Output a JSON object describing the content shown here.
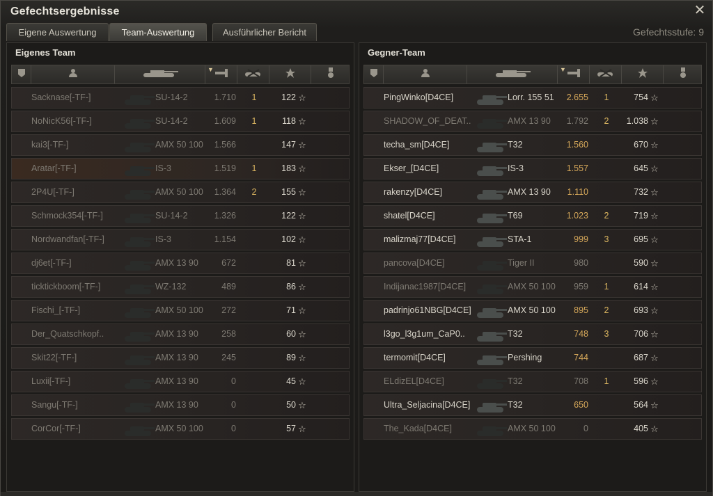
{
  "window": {
    "title": "Gefechtsergebnisse"
  },
  "tabs": [
    {
      "label": "Eigene Auswertung",
      "active": false
    },
    {
      "label": "Team-Auswertung",
      "active": true
    },
    {
      "label": "Ausführlicher Bericht",
      "active": false
    }
  ],
  "battle_tier": "Gefechtsstufe: 9",
  "colors": {
    "accent": "#d9b460",
    "enemy_damage": "#d6a85a",
    "highlight_row": "#3a2a20"
  },
  "header_icons": [
    "badge-icon",
    "player-icon",
    "tank-icon",
    "damage-icon",
    "kills-icon",
    "star-icon",
    "medal-icon"
  ],
  "own_team": {
    "title": "Eigenes Team",
    "players": [
      {
        "name": "Sacknase[-TF-]",
        "vehicle": "SU-14-2",
        "damage": "1.710",
        "kills": "1",
        "xp": "122",
        "dead": true
      },
      {
        "name": "NoNicK56[-TF-]",
        "vehicle": "SU-14-2",
        "damage": "1.609",
        "kills": "1",
        "xp": "118",
        "dead": true
      },
      {
        "name": "kai3[-TF-]",
        "vehicle": "AMX 50 100",
        "damage": "1.566",
        "kills": "",
        "xp": "147",
        "dead": true
      },
      {
        "name": "Aratar[-TF-]",
        "vehicle": "IS-3",
        "damage": "1.519",
        "kills": "1",
        "xp": "183",
        "dead": true,
        "highlight": true
      },
      {
        "name": "2P4U[-TF-]",
        "vehicle": "AMX 50 100",
        "damage": "1.364",
        "kills": "2",
        "xp": "155",
        "dead": true
      },
      {
        "name": "Schmock354[-TF-]",
        "vehicle": "SU-14-2",
        "damage": "1.326",
        "kills": "",
        "xp": "122",
        "dead": true
      },
      {
        "name": "Nordwandfan[-TF-]",
        "vehicle": "IS-3",
        "damage": "1.154",
        "kills": "",
        "xp": "102",
        "dead": true
      },
      {
        "name": "dj6et[-TF-]",
        "vehicle": "AMX 13 90",
        "damage": "672",
        "kills": "",
        "xp": "81",
        "dead": true
      },
      {
        "name": "ticktickboom[-TF-]",
        "vehicle": "WZ-132",
        "damage": "489",
        "kills": "",
        "xp": "86",
        "dead": true
      },
      {
        "name": "Fischi_[-TF-]",
        "vehicle": "AMX 50 100",
        "damage": "272",
        "kills": "",
        "xp": "71",
        "dead": true
      },
      {
        "name": "Der_Quatschkopf..",
        "vehicle": "AMX 13 90",
        "damage": "258",
        "kills": "",
        "xp": "60",
        "dead": true
      },
      {
        "name": "Skit22[-TF-]",
        "vehicle": "AMX 13 90",
        "damage": "245",
        "kills": "",
        "xp": "89",
        "dead": true
      },
      {
        "name": "Luxii[-TF-]",
        "vehicle": "AMX 13 90",
        "damage": "0",
        "kills": "",
        "xp": "45",
        "dead": true
      },
      {
        "name": "Sangu[-TF-]",
        "vehicle": "AMX 13 90",
        "damage": "0",
        "kills": "",
        "xp": "50",
        "dead": true
      },
      {
        "name": "CorCor[-TF-]",
        "vehicle": "AMX 50 100",
        "damage": "0",
        "kills": "",
        "xp": "57",
        "dead": true
      }
    ]
  },
  "enemy_team": {
    "title": "Gegner-Team",
    "players": [
      {
        "name": "PingWinko[D4CE]",
        "vehicle": "Lorr. 155 51",
        "damage": "2.655",
        "kills": "1",
        "xp": "754",
        "dead": false
      },
      {
        "name": "SHADOW_OF_DEAT..",
        "vehicle": "AMX 13 90",
        "damage": "1.792",
        "kills": "2",
        "xp": "1.038",
        "dead": true
      },
      {
        "name": "techa_sm[D4CE]",
        "vehicle": "T32",
        "damage": "1.560",
        "kills": "",
        "xp": "670",
        "dead": false
      },
      {
        "name": "Ekser_[D4CE]",
        "vehicle": "IS-3",
        "damage": "1.557",
        "kills": "",
        "xp": "645",
        "dead": false
      },
      {
        "name": "rakenzy[D4CE]",
        "vehicle": "AMX 13 90",
        "damage": "1.110",
        "kills": "",
        "xp": "732",
        "dead": false
      },
      {
        "name": "shatel[D4CE]",
        "vehicle": "T69",
        "damage": "1.023",
        "kills": "2",
        "xp": "719",
        "dead": false
      },
      {
        "name": "malizmaj77[D4CE]",
        "vehicle": "STA-1",
        "damage": "999",
        "kills": "3",
        "xp": "695",
        "dead": false
      },
      {
        "name": "pancova[D4CE]",
        "vehicle": "Tiger II",
        "damage": "980",
        "kills": "",
        "xp": "590",
        "dead": true
      },
      {
        "name": "Indijanac1987[D4CE]",
        "vehicle": "AMX 50 100",
        "damage": "959",
        "kills": "1",
        "xp": "614",
        "dead": true
      },
      {
        "name": "padrinjo61NBG[D4CE]",
        "vehicle": "AMX 50 100",
        "damage": "895",
        "kills": "2",
        "xp": "693",
        "dead": false
      },
      {
        "name": "l3go_l3g1um_CaP0..",
        "vehicle": "T32",
        "damage": "748",
        "kills": "3",
        "xp": "706",
        "dead": false
      },
      {
        "name": "termomit[D4CE]",
        "vehicle": "Pershing",
        "damage": "744",
        "kills": "",
        "xp": "687",
        "dead": false
      },
      {
        "name": "ELdizEL[D4CE]",
        "vehicle": "T32",
        "damage": "708",
        "kills": "1",
        "xp": "596",
        "dead": true
      },
      {
        "name": "Ultra_Seljacina[D4CE]",
        "vehicle": "T32",
        "damage": "650",
        "kills": "",
        "xp": "564",
        "dead": false
      },
      {
        "name": "The_Kada[D4CE]",
        "vehicle": "AMX 50 100",
        "damage": "0",
        "kills": "",
        "xp": "405",
        "dead": true
      }
    ]
  }
}
